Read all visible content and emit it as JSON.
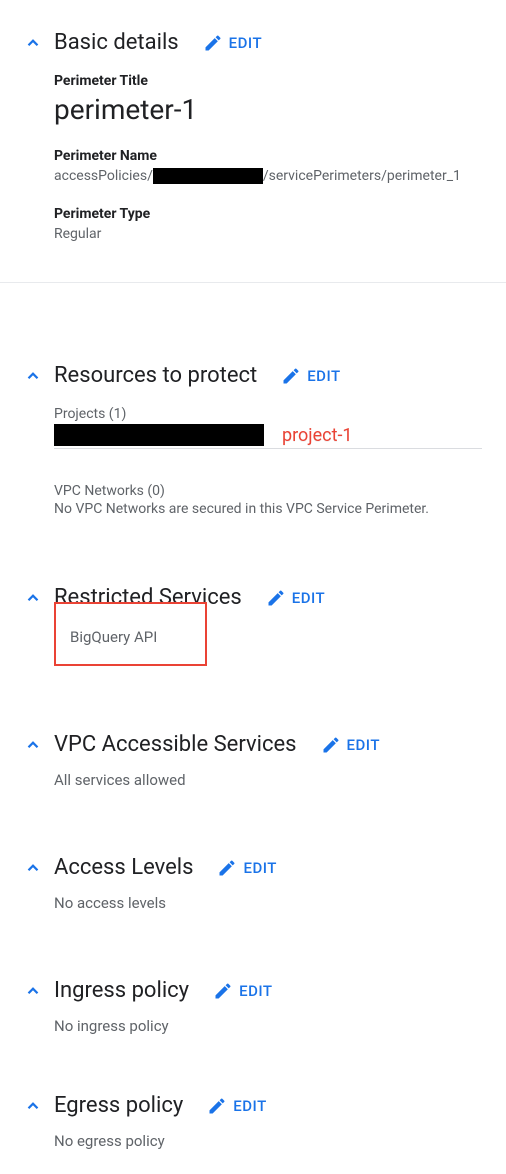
{
  "edit_label": "EDIT",
  "basic_details": {
    "title": "Basic details",
    "perimeter_title_label": "Perimeter Title",
    "perimeter_title_value": "perimeter-1",
    "perimeter_name_label": "Perimeter Name",
    "perimeter_name_prefix": "accessPolicies/",
    "perimeter_name_suffix": "/servicePerimeters/perimeter_1",
    "perimeter_type_label": "Perimeter Type",
    "perimeter_type_value": "Regular"
  },
  "resources": {
    "title": "Resources to protect",
    "projects_label": "Projects (1)",
    "project_name": "project-1",
    "vpc_count": "VPC Networks (0)",
    "vpc_message": "No VPC Networks are secured in this VPC Service Perimeter."
  },
  "restricted": {
    "title": "Restricted Services",
    "item": "BigQuery API"
  },
  "vpc_accessible": {
    "title": "VPC Accessible Services",
    "message": "All services allowed"
  },
  "access_levels": {
    "title": "Access Levels",
    "message": "No access levels"
  },
  "ingress": {
    "title": "Ingress policy",
    "message": "No ingress policy"
  },
  "egress": {
    "title": "Egress policy",
    "message": "No egress policy"
  }
}
